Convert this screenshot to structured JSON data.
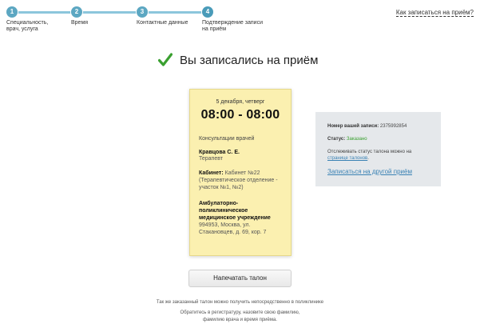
{
  "steps": [
    {
      "number": "1",
      "label": "Специальность, врач, услуга"
    },
    {
      "number": "2",
      "label": "Время"
    },
    {
      "number": "3",
      "label": "Контактные данные"
    },
    {
      "number": "4",
      "label": "Подтверждение записи на приём"
    }
  ],
  "howto_link": "Как записаться на приём?",
  "success_title": "Вы записались на приём",
  "ticket": {
    "date": "5 декабря, четверг",
    "time": "08:00 - 08:00",
    "service": "Консультации врачей",
    "doctor": "Кравцова С. Е.",
    "specialty": "Терапевт",
    "cabinet_label": "Кабинет:",
    "cabinet_value": "Кабинет №22 (Терапевтическое отделение - участок №1, №2)",
    "org": "Амбулаторно-поликлиническое медицинское учреждение",
    "address": "994953, Москва, ул. Стакановцев, д. 69, кор. 7"
  },
  "info": {
    "number_label": "Номер вашей записи:",
    "number_value": "2375992854",
    "status_label": "Статус:",
    "status_value": "Заказано",
    "track_text": "Отслеживать статус талона можно на",
    "track_link": "странице талонов",
    "track_end": ".",
    "other_link": "Записаться на другой приём"
  },
  "print_button": "Напечатать талон",
  "note_line1": "Так же заказанный талон можно получить непосредственно в поликлинике",
  "note_line2": "Обратитесь в регистратуру, назовите свою фамилию,",
  "note_line3": "фамилию врача и время приёма.",
  "colors": {
    "accent": "#5ca7c2",
    "ticket_bg": "#fbf0b0",
    "status_green": "#3aa030",
    "link": "#3a82b4"
  }
}
